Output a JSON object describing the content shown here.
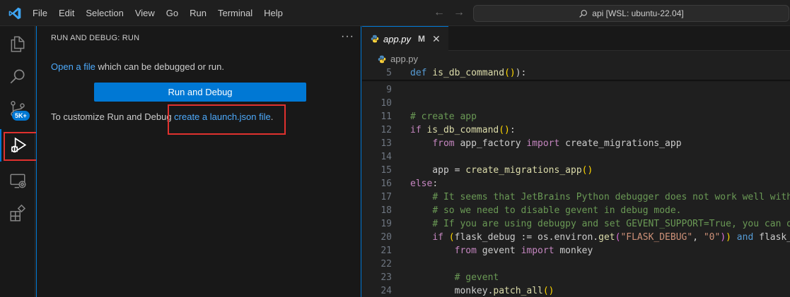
{
  "titlebar": {
    "menu": [
      "File",
      "Edit",
      "Selection",
      "View",
      "Go",
      "Run",
      "Terminal",
      "Help"
    ],
    "command_center": "api [WSL: ubuntu-22.04]"
  },
  "activitybar": {
    "items": [
      "explorer-icon",
      "search-icon",
      "source-control-icon",
      "run-debug-icon",
      "remote-explorer-icon",
      "extensions-icon"
    ],
    "badge": "5K+"
  },
  "sidebar": {
    "title": "RUN AND DEBUG: RUN",
    "more": "···",
    "open_file_link": "Open a file",
    "open_file_suffix": " which can be debugged or run.",
    "run_button": "Run and Debug",
    "customize_prefix": "To customize Run and Debug ",
    "launch_link": "create a launch.json file",
    "customize_suffix": "."
  },
  "editor": {
    "tab": {
      "name": "app.py",
      "modified": "M",
      "close": "✕"
    },
    "breadcrumb": "app.py",
    "lines": [
      {
        "n": "5",
        "segs": [
          [
            "kw",
            "def "
          ],
          [
            "fn",
            "is_db_command"
          ],
          [
            "pn",
            "()"
          ],
          [
            "",
            "):"
          ]
        ]
      },
      {
        "n": "9",
        "segs": []
      },
      {
        "n": "10",
        "segs": []
      },
      {
        "n": "11",
        "segs": [
          [
            "cm",
            "# create app"
          ]
        ]
      },
      {
        "n": "12",
        "segs": [
          [
            "kc",
            "if "
          ],
          [
            "fn",
            "is_db_command"
          ],
          [
            "pn",
            "()"
          ],
          [
            "",
            ":"
          ]
        ]
      },
      {
        "n": "13",
        "segs": [
          [
            "",
            "    "
          ],
          [
            "kc",
            "from "
          ],
          [
            "",
            "app_factory "
          ],
          [
            "kc",
            "import "
          ],
          [
            "",
            "create_migrations_app"
          ]
        ]
      },
      {
        "n": "14",
        "segs": []
      },
      {
        "n": "15",
        "segs": [
          [
            "",
            "    app = "
          ],
          [
            "fn",
            "create_migrations_app"
          ],
          [
            "pn",
            "()"
          ]
        ]
      },
      {
        "n": "16",
        "segs": [
          [
            "kc",
            "else"
          ],
          [
            "",
            ":"
          ]
        ]
      },
      {
        "n": "17",
        "segs": [
          [
            "",
            "    "
          ],
          [
            "cm",
            "# It seems that JetBrains Python debugger does not work well with"
          ]
        ]
      },
      {
        "n": "18",
        "segs": [
          [
            "",
            "    "
          ],
          [
            "cm",
            "# so we need to disable gevent in debug mode."
          ]
        ]
      },
      {
        "n": "19",
        "segs": [
          [
            "",
            "    "
          ],
          [
            "cm",
            "# If you are using debugpy and set GEVENT_SUPPORT=True, you can de"
          ]
        ]
      },
      {
        "n": "20",
        "segs": [
          [
            "",
            "    "
          ],
          [
            "kc",
            "if "
          ],
          [
            "pn",
            "("
          ],
          [
            "",
            "flask_debug := os.environ."
          ],
          [
            "fn",
            "get"
          ],
          [
            "pn2",
            "("
          ],
          [
            "str",
            "\"FLASK_DEBUG\""
          ],
          [
            "",
            ", "
          ],
          [
            "str",
            "\"0\""
          ],
          [
            "pn2",
            ")"
          ],
          [
            "pn",
            ")"
          ],
          [
            "kw",
            " and "
          ],
          [
            "",
            "flask_d"
          ]
        ]
      },
      {
        "n": "21",
        "segs": [
          [
            "",
            "        "
          ],
          [
            "kc",
            "from "
          ],
          [
            "",
            "gevent "
          ],
          [
            "kc",
            "import "
          ],
          [
            "",
            "monkey"
          ]
        ]
      },
      {
        "n": "22",
        "segs": []
      },
      {
        "n": "23",
        "segs": [
          [
            "",
            "        "
          ],
          [
            "cm",
            "# gevent"
          ]
        ]
      },
      {
        "n": "24",
        "segs": [
          [
            "",
            "        monkey."
          ],
          [
            "fn",
            "patch_all"
          ],
          [
            "pn",
            "()"
          ]
        ]
      }
    ]
  }
}
